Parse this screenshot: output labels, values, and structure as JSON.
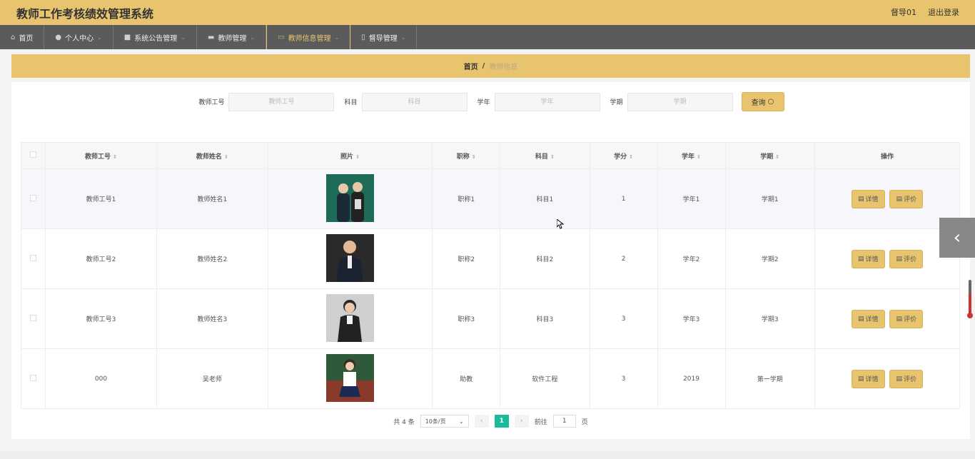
{
  "header": {
    "title": "教师工作考核绩效管理系统",
    "user": "督导01",
    "logout": "退出登录"
  },
  "nav": {
    "items": [
      {
        "label": "首页",
        "icon": "home-icon",
        "caret": ""
      },
      {
        "label": "个人中心",
        "icon": "user-icon",
        "caret": "⌄"
      },
      {
        "label": "系统公告管理",
        "icon": "briefcase-icon",
        "caret": "⌄"
      },
      {
        "label": "教师管理",
        "icon": "card-icon",
        "caret": "⌄"
      },
      {
        "label": "教师信息管理",
        "icon": "chat-icon",
        "caret": "⌄"
      },
      {
        "label": "督导管理",
        "icon": "badge-icon",
        "caret": "⌄"
      }
    ]
  },
  "breadcrumb": {
    "home": "首页",
    "sep": "/",
    "current": "教师信息"
  },
  "search": {
    "fields": [
      {
        "label": "教师工号",
        "placeholder": "教师工号"
      },
      {
        "label": "科目",
        "placeholder": "科目"
      },
      {
        "label": "学年",
        "placeholder": "学年"
      },
      {
        "label": "学期",
        "placeholder": "学期"
      }
    ],
    "button": "查询"
  },
  "table": {
    "headers": [
      "教师工号",
      "教师姓名",
      "照片",
      "职称",
      "科目",
      "学分",
      "学年",
      "学期",
      "操作"
    ],
    "rows": [
      {
        "id": "教师工号1",
        "name": "教师姓名1",
        "title": "职称1",
        "subject": "科目1",
        "credit": "1",
        "year": "学年1",
        "term": "学期1"
      },
      {
        "id": "教师工号2",
        "name": "教师姓名2",
        "title": "职称2",
        "subject": "科目2",
        "credit": "2",
        "year": "学年2",
        "term": "学期2"
      },
      {
        "id": "教师工号3",
        "name": "教师姓名3",
        "title": "职称3",
        "subject": "科目3",
        "credit": "3",
        "year": "学年3",
        "term": "学期3"
      },
      {
        "id": "000",
        "name": "吴老师",
        "title": "助教",
        "subject": "软件工程",
        "credit": "3",
        "year": "2019",
        "term": "第一学期"
      }
    ],
    "detail_label": "详情",
    "review_label": "评价"
  },
  "pager": {
    "total": "共 4 条",
    "per_page": "10条/页",
    "current": "1",
    "goto_prefix": "前往",
    "goto_value": "1",
    "goto_suffix": "页"
  },
  "colors": {
    "accent": "#e8c46f",
    "nav_bg": "#5b5b5b",
    "page_active": "#1abc9c"
  }
}
